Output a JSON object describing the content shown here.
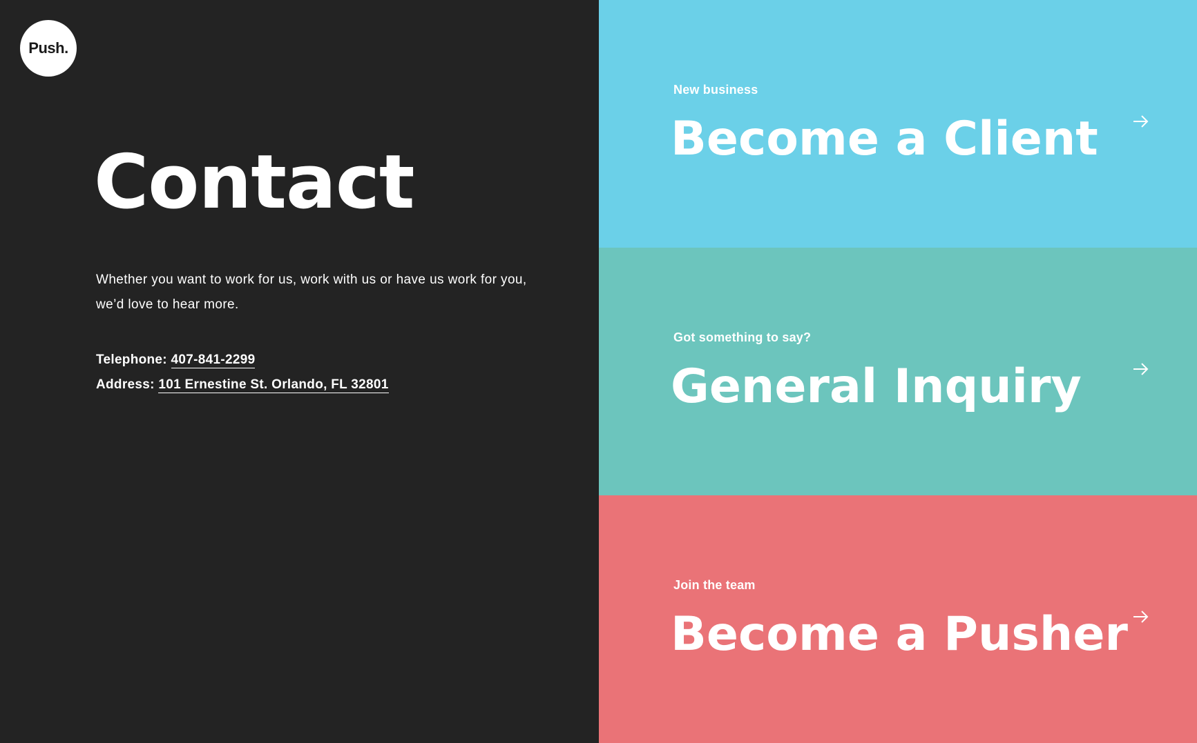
{
  "logo": {
    "text": "Push."
  },
  "page_title": "Contact",
  "intro_text": "Whether you want to work for us, work with us or have us work for you, we’d love to hear more.",
  "contact": {
    "telephone_label": "Telephone:",
    "telephone_value": "407-841-2299",
    "address_label": "Address:",
    "address_value": "101 Ernestine St. Orlando, FL 32801"
  },
  "cards": [
    {
      "eyebrow": "New business",
      "heading": "Become a Client",
      "color": "#6bd0e8",
      "icon": "arrow-right-icon"
    },
    {
      "eyebrow": "Got something to say?",
      "heading": "General Inquiry",
      "color": "#6cc5bd",
      "icon": "arrow-right-icon"
    },
    {
      "eyebrow": "Join the team",
      "heading": "Become a Pusher",
      "color": "#ea7377",
      "icon": "arrow-right-icon"
    }
  ],
  "colors": {
    "left_background": "#232323",
    "text": "#ffffff"
  }
}
